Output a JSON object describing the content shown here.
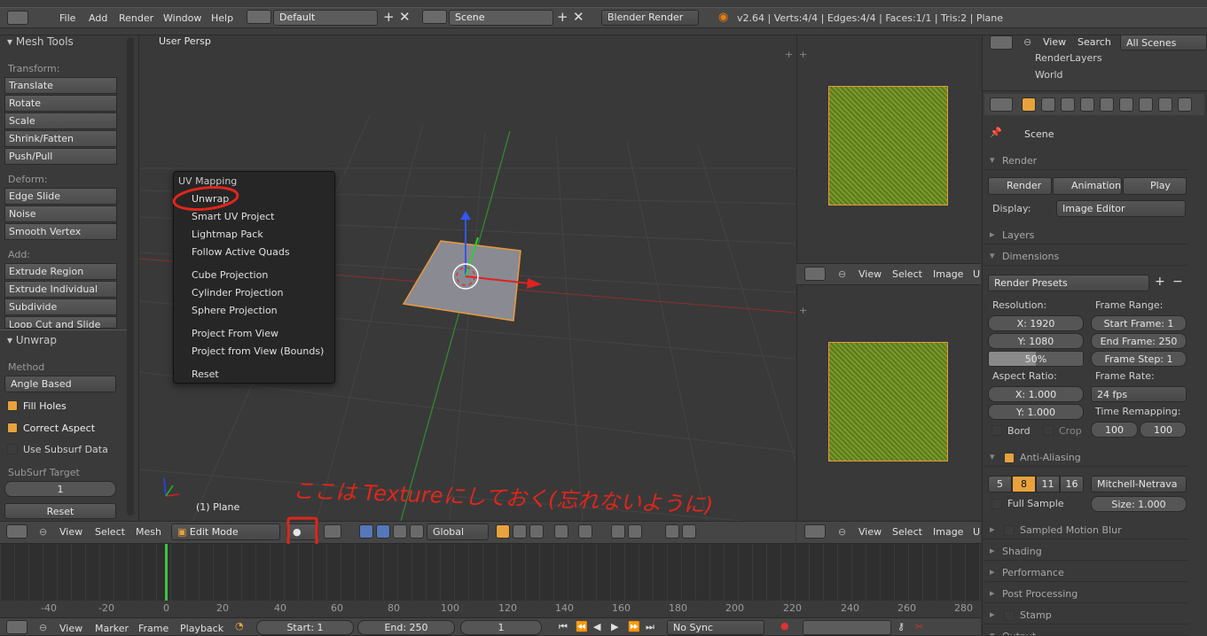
{
  "topbar": {
    "menus": [
      "File",
      "Add",
      "Render",
      "Window",
      "Help"
    ],
    "layout": "Default",
    "scene": "Scene",
    "engine": "Blender Render",
    "stats": "v2.64 | Verts:4/4 | Edges:4/4 | Faces:1/1 | Tris:2 | Plane"
  },
  "toolshelf": {
    "title": "Mesh Tools",
    "transform_label": "Transform:",
    "transform": [
      "Translate",
      "Rotate",
      "Scale",
      "Shrink/Fatten",
      "Push/Pull"
    ],
    "deform_label": "Deform:",
    "deform": [
      "Edge Slide",
      "Noise",
      "Smooth Vertex"
    ],
    "add_label": "Add:",
    "add": [
      "Extrude Region",
      "Extrude Individual",
      "Subdivide",
      "Loop Cut and Slide"
    ]
  },
  "unwrap": {
    "title": "Unwrap",
    "method_label": "Method",
    "method": "Angle Based",
    "fill_holes": "Fill Holes",
    "correct_aspect": "Correct Aspect",
    "use_subsurf": "Use Subsurf Data",
    "subsurf_label": "SubSurf Target",
    "subsurf_value": "1",
    "reset": "Reset"
  },
  "viewport": {
    "label": "User Persp",
    "object": "(1) Plane"
  },
  "uv_menu": {
    "title": "UV Mapping",
    "items": [
      "Unwrap",
      "Smart UV Project",
      "Lightmap Pack",
      "Follow Active Quads",
      "Cube Projection",
      "Cylinder Projection",
      "Sphere Projection",
      "Project From View",
      "Project from View (Bounds)",
      "Reset"
    ]
  },
  "annotation": "ここは Textureにしておく(忘れないように)",
  "view_header": {
    "menus": [
      "View",
      "Select",
      "Mesh"
    ],
    "mode": "Edit Mode",
    "orientation": "Global"
  },
  "image_header": {
    "menus": [
      "View",
      "Select",
      "Image",
      "U"
    ]
  },
  "timeline": {
    "ticks": [
      "-40",
      "-20",
      "0",
      "20",
      "40",
      "60",
      "80",
      "100",
      "120",
      "140",
      "160",
      "180",
      "200",
      "220",
      "240",
      "260",
      "280"
    ],
    "menus": [
      "View",
      "Marker",
      "Frame",
      "Playback"
    ],
    "start": "Start: 1",
    "end": "End: 250",
    "current": "1",
    "sync": "No Sync"
  },
  "outliner": {
    "menus": [
      "View",
      "Search"
    ],
    "scenes": "All Scenes",
    "items": [
      "RenderLayers",
      "World"
    ]
  },
  "properties": {
    "scene": "Scene",
    "render_panel": "Render",
    "render_btn": "Render",
    "animation_btn": "Animation",
    "play_btn": "Play",
    "display_label": "Display:",
    "display_value": "Image Editor",
    "layers": "Layers",
    "dimensions": "Dimensions",
    "presets": "Render Presets",
    "resolution_label": "Resolution:",
    "res_x": "X: 1920",
    "res_y": "Y: 1080",
    "res_pct": "50%",
    "frame_range_label": "Frame Range:",
    "start_frame": "Start Frame: 1",
    "end_frame": "End Frame: 250",
    "frame_step": "Frame Step: 1",
    "aspect_label": "Aspect Ratio:",
    "asp_x": "X: 1.000",
    "asp_y": "Y: 1.000",
    "frame_rate_label": "Frame Rate:",
    "fps": "24 fps",
    "time_remap": "Time Remapping:",
    "remap_old": "100",
    "remap_new": "100",
    "bord": "Bord",
    "crop": "Crop",
    "antialiasing": "Anti-Aliasing",
    "aa_samples": [
      "5",
      "8",
      "11",
      "16"
    ],
    "aa_filter": "Mitchell-Netrava",
    "full_sample": "Full Sample",
    "size": "Size: 1.000",
    "motion_blur": "Sampled Motion Blur",
    "shading": "Shading",
    "performance": "Performance",
    "post_processing": "Post Processing",
    "stamp": "Stamp",
    "output": "Output"
  },
  "colors": {
    "accent": "#e8a23c",
    "uv_green": "#7a9a2a",
    "annotation_red": "#e0261c"
  }
}
